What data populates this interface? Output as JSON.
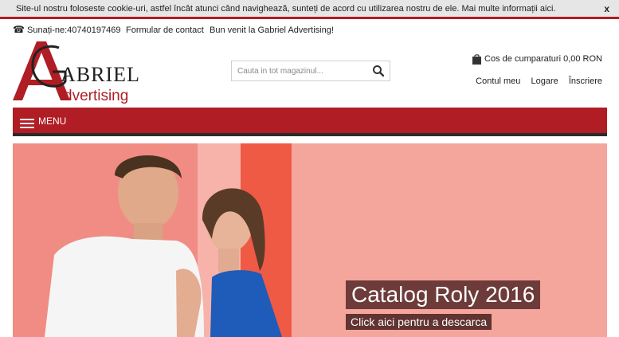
{
  "cookie_bar": {
    "text": "Site-ul nostru foloseste cookie-uri, astfel încât atunci când navighează, sunteți de acord cu utilizarea nostru de ele. Mai multe informații aici.",
    "close_label": "x"
  },
  "topbar": {
    "phone_icon": "phone-icon",
    "phone_text": "Sunați-ne:40740197469",
    "contact_link": "Formular de contact",
    "welcome": "Bun venit la Gabriel Advertising!"
  },
  "logo": {
    "line1": "GABRIEL",
    "line2": "dvertising",
    "brand_red": "#b01d24"
  },
  "search": {
    "placeholder": "Cauta in tot magazinul...",
    "icon": "search-icon"
  },
  "cart": {
    "label": "Cos de cumparaturi 0,00 RON",
    "icon": "shopping-bag-icon"
  },
  "account": {
    "my_account": "Contul meu",
    "login": "Logare",
    "register": "Înscriere"
  },
  "nav": {
    "menu_label": "MENU",
    "menu_icon": "hamburger-icon"
  },
  "hero": {
    "title": "Catalog Roly 2016",
    "cta": "Click aici pentru a descarca",
    "bg_color": "#f3a39b"
  },
  "colors": {
    "accent": "#b01d24",
    "dark": "#2b2b2b"
  }
}
